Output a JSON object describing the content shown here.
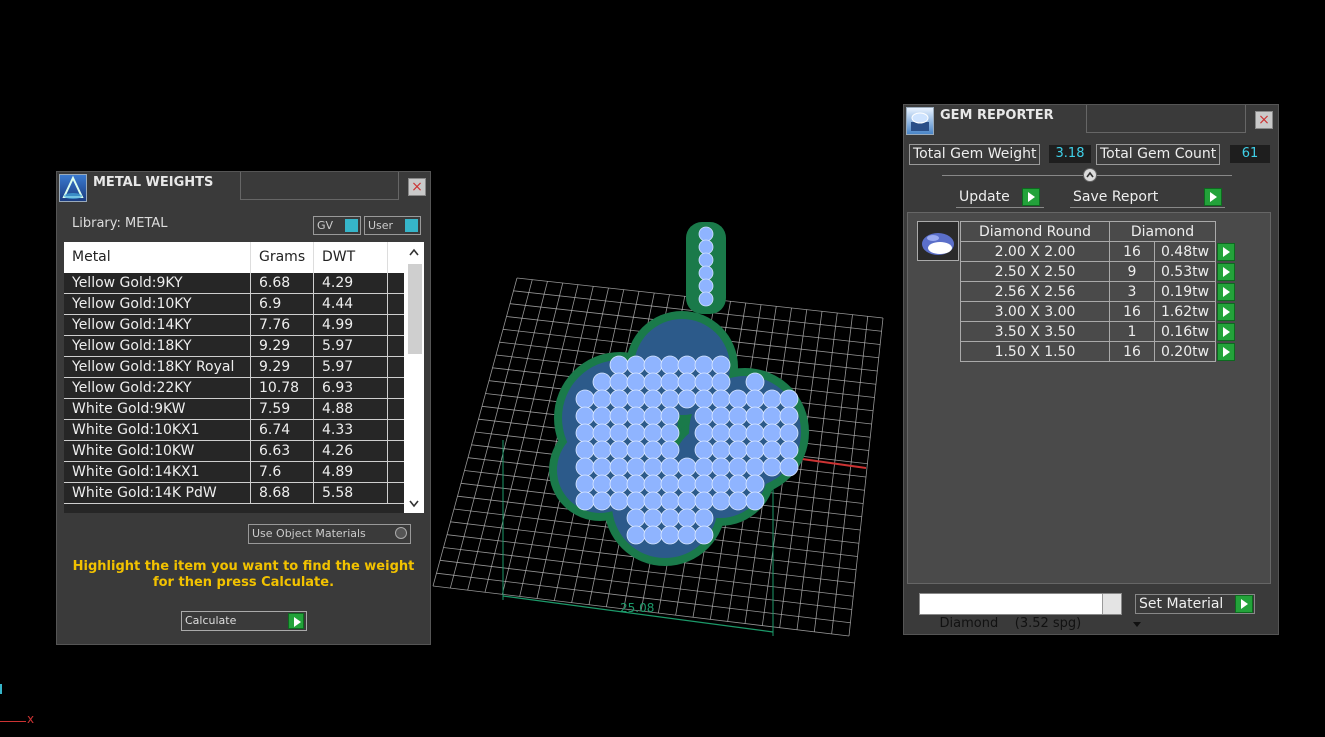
{
  "metal_weights": {
    "title": "METAL WEIGHTS",
    "close_label": "×",
    "library_label": "Library: METAL",
    "toggle_gv": "GV",
    "toggle_user": "User",
    "columns": [
      "Metal",
      "Grams",
      "DWT"
    ],
    "rows": [
      {
        "metal": "Yellow Gold:9KY",
        "grams": "6.68",
        "dwt": "4.29"
      },
      {
        "metal": "Yellow Gold:10KY",
        "grams": "6.9",
        "dwt": "4.44"
      },
      {
        "metal": "Yellow Gold:14KY",
        "grams": "7.76",
        "dwt": "4.99"
      },
      {
        "metal": "Yellow Gold:18KY",
        "grams": "9.29",
        "dwt": "5.97"
      },
      {
        "metal": "Yellow Gold:18KY Royal",
        "grams": "9.29",
        "dwt": "5.97"
      },
      {
        "metal": "Yellow Gold:22KY",
        "grams": "10.78",
        "dwt": "6.93"
      },
      {
        "metal": "White Gold:9KW",
        "grams": "7.59",
        "dwt": "4.88"
      },
      {
        "metal": "White Gold:10KX1",
        "grams": "6.74",
        "dwt": "4.33"
      },
      {
        "metal": "White Gold:10KW",
        "grams": "6.63",
        "dwt": "4.26"
      },
      {
        "metal": "White Gold:14KX1",
        "grams": "7.6",
        "dwt": "4.89"
      },
      {
        "metal": "White Gold:14K PdW",
        "grams": "8.68",
        "dwt": "5.58"
      }
    ],
    "use_object_materials": "Use Object Materials",
    "hint_line1": "Highlight the item you want to find the weight",
    "hint_line2": "for then press Calculate.",
    "calculate_label": "Calculate",
    "hint_color": "#f2c200"
  },
  "gem_reporter": {
    "title": "GEM REPORTER",
    "close_label": "×",
    "total_weight_label": "Total Gem Weight",
    "total_weight_value": "3.18",
    "total_count_label": "Total Gem Count",
    "total_count_value": "61",
    "update_label": "Update",
    "save_report_label": "Save Report",
    "table_header_shape": "Diamond Round",
    "table_header_material": "Diamond",
    "rows": [
      {
        "size": "2.00 X 2.00",
        "count": "16",
        "weight": "0.48tw"
      },
      {
        "size": "2.50 X 2.50",
        "count": "9",
        "weight": "0.53tw"
      },
      {
        "size": "2.56 X 2.56",
        "count": "3",
        "weight": "0.19tw"
      },
      {
        "size": "3.00 X 3.00",
        "count": "16",
        "weight": "1.62tw"
      },
      {
        "size": "3.50 X 3.50",
        "count": "1",
        "weight": "0.16tw"
      },
      {
        "size": "1.50 X 1.50",
        "count": "16",
        "weight": "0.20tw"
      }
    ],
    "material_select_value": "Diamond    (3.52 spg)",
    "set_material_label": "Set Material",
    "value_color": "#3fd0e8"
  },
  "viewport": {
    "dimension_label": "25.08",
    "axis_x_label": "x",
    "grid_color": "#bbbbbb",
    "metal_color": "#1a7a4a",
    "gem_color": "#8fb4ff"
  }
}
